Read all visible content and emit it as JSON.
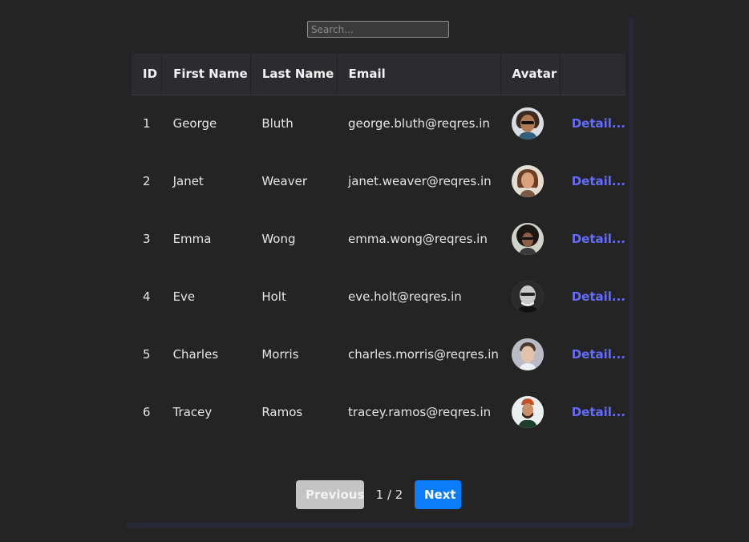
{
  "search": {
    "placeholder": "Search..."
  },
  "table": {
    "headers": {
      "id": "ID",
      "first_name": "First Name",
      "last_name": "Last Name",
      "email": "Email",
      "avatar": "Avatar",
      "actions": ""
    },
    "rows": [
      {
        "id": "1",
        "first_name": "George",
        "last_name": "Bluth",
        "email": "george.bluth@reqres.in",
        "avatar": "avatar-photo",
        "details": "Detail..."
      },
      {
        "id": "2",
        "first_name": "Janet",
        "last_name": "Weaver",
        "email": "janet.weaver@reqres.in",
        "avatar": "avatar-photo",
        "details": "Detail..."
      },
      {
        "id": "3",
        "first_name": "Emma",
        "last_name": "Wong",
        "email": "emma.wong@reqres.in",
        "avatar": "avatar-photo",
        "details": "Detail..."
      },
      {
        "id": "4",
        "first_name": "Eve",
        "last_name": "Holt",
        "email": "eve.holt@reqres.in",
        "avatar": "avatar-photo",
        "details": "Detail..."
      },
      {
        "id": "5",
        "first_name": "Charles",
        "last_name": "Morris",
        "email": "charles.morris@reqres.in",
        "avatar": "avatar-photo",
        "details": "Detail..."
      },
      {
        "id": "6",
        "first_name": "Tracey",
        "last_name": "Ramos",
        "email": "tracey.ramos@reqres.in",
        "avatar": "avatar-photo",
        "details": "Detail..."
      }
    ]
  },
  "pagination": {
    "previous_label": "Previous",
    "next_label": "Next",
    "indicator": "1 / 2"
  },
  "colors": {
    "background": "#242424",
    "link": "#646cff",
    "next_button": "#0b7dfa",
    "previous_button_disabled": "#c4c4c4"
  }
}
